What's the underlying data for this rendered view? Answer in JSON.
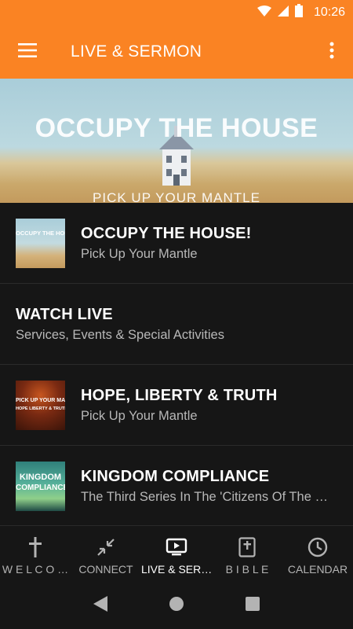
{
  "status_bar": {
    "time": "10:26"
  },
  "app_bar": {
    "title": "LIVE & SERMON"
  },
  "hero": {
    "title": "OCCUPY THE HOUSE",
    "subtitle": "PICK UP YOUR MANTLE"
  },
  "items": [
    {
      "title": "OCCUPY THE HOUSE!",
      "subtitle": "Pick Up Your Mantle",
      "thumb_text": "OCCUPY THE HOUSE"
    },
    {
      "title": "WATCH LIVE",
      "subtitle": "Services, Events & Special Activities"
    },
    {
      "title": "HOPE, LIBERTY & TRUTH",
      "subtitle": "Pick Up Your Mantle",
      "thumb_text": "PICK UP YOUR MANTLE",
      "thumb_text2": "HOPE LIBERTY & TRUTH"
    },
    {
      "title": "KINGDOM COMPLIANCE",
      "subtitle": "The Third Series In The 'Citizens Of The Kingdom' Series",
      "thumb_text": "KINGDOM",
      "thumb_text2": "COMPLIANCE"
    }
  ],
  "bottom_nav": [
    {
      "label": "W E L C O …",
      "icon": "cross-icon"
    },
    {
      "label": "CONNECT",
      "icon": "compress-arrows-icon"
    },
    {
      "label": "LIVE & SER…",
      "icon": "live-tv-icon",
      "active": true
    },
    {
      "label": "B I B L E",
      "icon": "bible-icon"
    },
    {
      "label": "CALENDAR",
      "icon": "clock-icon"
    }
  ],
  "colors": {
    "accent": "#fa8323",
    "background": "#161616"
  }
}
